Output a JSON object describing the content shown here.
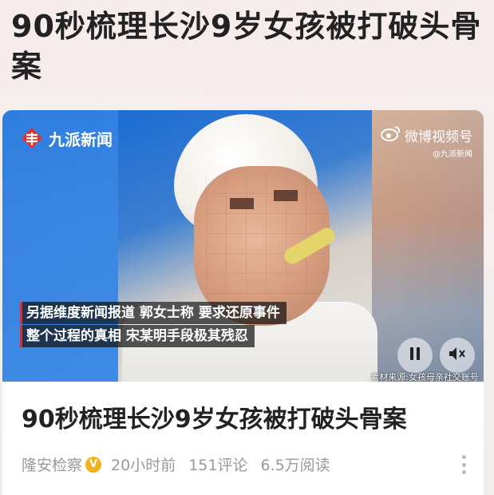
{
  "page": {
    "headline": "90秒梳理长沙9岁女孩被打破头骨案"
  },
  "video": {
    "logo_left_text": "九派新闻",
    "logo_right_text": "微博视频号",
    "logo_right_handle": "@九派新闻",
    "subtitle_line1": "另据维度新闻报道 郭女士称 要求还原事件",
    "subtitle_line2": "整个过程的真相 宋某明手段极其残忍",
    "source_note": "素材来源:女孩母亲社交账号",
    "controls": {
      "pause_icon": "pause-icon",
      "mute_icon": "mute-icon"
    },
    "colors": {
      "accent_red": "#d8302c"
    }
  },
  "article": {
    "title": "90秒梳理长沙9岁女孩被打破头骨案",
    "author": "隆安检察",
    "verified_badge": "V",
    "time": "20小时前",
    "comments": "151评论",
    "views": "6.5万阅读",
    "more_icon": "more-vertical-icon"
  }
}
